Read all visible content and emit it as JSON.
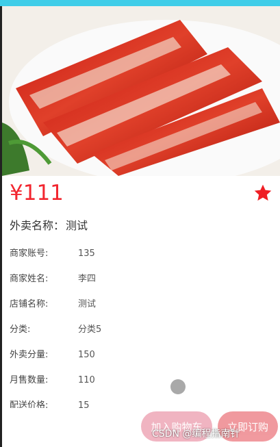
{
  "product": {
    "image_alt": "roast-pork-photo",
    "price": "¥111",
    "favorite_icon": "star-icon",
    "name_label": "外卖名称：",
    "name_value": "测试"
  },
  "details": [
    {
      "label": "商家账号:",
      "value": "135"
    },
    {
      "label": "商家姓名:",
      "value": "李四"
    },
    {
      "label": "店铺名称:",
      "value": "测试"
    },
    {
      "label": "分类:",
      "value": "分类5"
    },
    {
      "label": "外卖分量:",
      "value": "150"
    },
    {
      "label": "月售数量:",
      "value": "110"
    },
    {
      "label": "配送价格:",
      "value": "15"
    }
  ],
  "actions": {
    "add_to_cart": "加入购物车",
    "buy_now": "立即订购"
  },
  "watermark": "CSDN @编程指南针",
  "colors": {
    "accent": "#f2262f",
    "top_bar": "#3fcde8"
  }
}
